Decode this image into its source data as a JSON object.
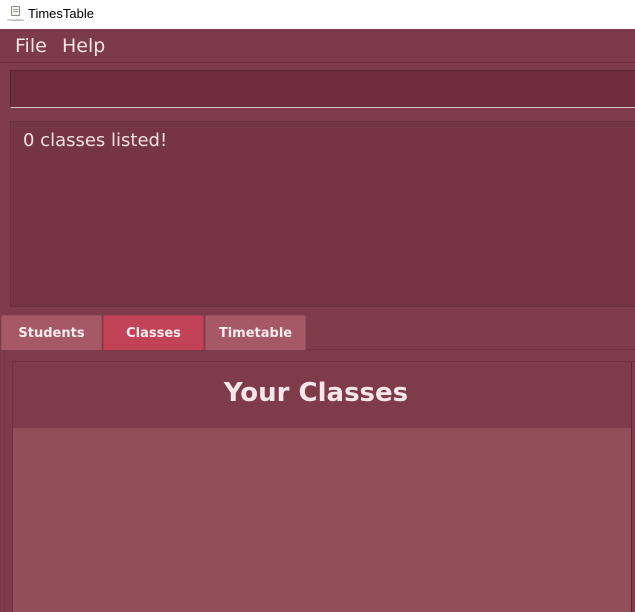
{
  "window": {
    "title": "TimesTable",
    "icon_name": "timestable-book-icon",
    "icon_caption": "TimesTable"
  },
  "menu": {
    "items": [
      {
        "label": "File"
      },
      {
        "label": "Help"
      }
    ]
  },
  "command_box": {
    "value": "",
    "placeholder": ""
  },
  "result": {
    "text": "0 classes listed!"
  },
  "tabs": [
    {
      "label": "Students",
      "active": false
    },
    {
      "label": "Classes",
      "active": true
    },
    {
      "label": "Timetable",
      "active": false
    }
  ],
  "classes_panel": {
    "title": "Your Classes",
    "items": []
  },
  "colors": {
    "background": "#7e3b49",
    "active_tab": "#c24258",
    "inactive_tab": "#a75866",
    "list_background": "#8f5059"
  }
}
